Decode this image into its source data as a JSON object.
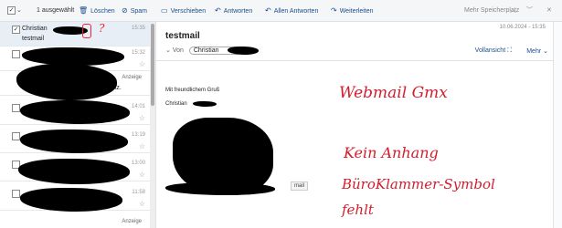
{
  "toolbar": {
    "selected_count": "1 ausgewählt",
    "delete": "Löschen",
    "spam": "Spam",
    "move": "Verschieben",
    "reply": "Antworten",
    "reply_all": "Allen Antworten",
    "forward": "Weiterleiten",
    "more_storage": "Mehr Speicherplatz"
  },
  "list": {
    "rows": [
      {
        "from": "Christian",
        "subject": "testmail",
        "time": "15:35"
      },
      {
        "time": "15:32"
      },
      {
        "ad": "Anzeige",
        "subject": "latz."
      },
      {
        "time": "14:01"
      },
      {
        "time": "13:19"
      },
      {
        "time": "13:00"
      },
      {
        "time": "11:58"
      },
      {
        "ad": "Anzeige"
      }
    ]
  },
  "preview": {
    "subject": "testmail",
    "date": "10.06.2024 - 15:35",
    "from_label": "Von",
    "from_name": "Christian",
    "full_view": "Vollansicht",
    "more": "Mehr",
    "greeting": "Mit freundlichem Gruß",
    "signature": "Christian",
    "tooltip": "mail"
  },
  "annotations": {
    "title": "Webmail Gmx",
    "line1": "Kein Anhang",
    "line2": "BüroKlammer-Symbol",
    "line3": "fehlt",
    "question": "?"
  }
}
